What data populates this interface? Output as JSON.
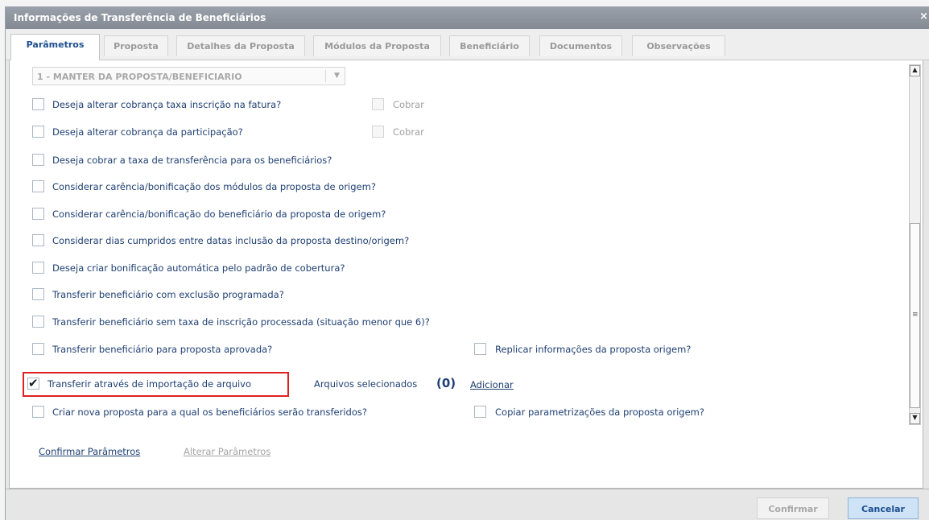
{
  "window": {
    "title": "Informações de Transferência de Beneficiários",
    "close_label": "×"
  },
  "tabs": [
    {
      "label": "Parâmetros",
      "active": true
    },
    {
      "label": "Proposta"
    },
    {
      "label": "Detalhes da Proposta"
    },
    {
      "label": "Módulos da Proposta"
    },
    {
      "label": "Beneficiário"
    },
    {
      "label": "Documentos"
    },
    {
      "label": "Observações"
    }
  ],
  "select": {
    "value": "1 - MANTER DA PROPOSTA/BENEFICIARIO",
    "arrow": "▼"
  },
  "options": [
    {
      "label": "Deseja alterar cobrança taxa inscrição na fatura?",
      "checked": false,
      "extra": {
        "label": "Cobrar",
        "disabled": true
      }
    },
    {
      "label": "Deseja alterar cobrança da participação?",
      "checked": false,
      "extra": {
        "label": "Cobrar",
        "disabled": true
      }
    },
    {
      "label": "Deseja cobrar a taxa de transferência para os beneficiários?",
      "checked": false
    },
    {
      "label": "Considerar carência/bonificação dos módulos da proposta de origem?",
      "checked": false
    },
    {
      "label": "Considerar carência/bonificação do beneficiário da proposta de origem?",
      "checked": false
    },
    {
      "label": "Considerar dias cumpridos entre datas inclusão da proposta destino/origem?",
      "checked": false
    },
    {
      "label": "Deseja criar bonificação automática pelo padrão de cobertura?",
      "checked": false
    },
    {
      "label": "Transferir beneficiário com exclusão programada?",
      "checked": false
    },
    {
      "label": "Transferir beneficiário sem taxa de inscrição processada (situação menor que 6)?",
      "checked": false
    },
    {
      "label": "Transferir beneficiário para proposta aprovada?",
      "checked": false,
      "extra": {
        "label": "Replicar informações da proposta origem?",
        "disabled": false
      }
    },
    {
      "label": "Transferir através de importação de arquivo",
      "checked": true,
      "check_glyph": "✔"
    },
    {
      "label": "Criar nova proposta para a qual os beneficiários serão transferidos?",
      "checked": false,
      "extra": {
        "label": "Copiar parametrizações da proposta origem?",
        "disabled": false
      }
    }
  ],
  "files": {
    "label": "Arquivos selecionados",
    "count": "(0)",
    "add_link": "Adicionar"
  },
  "links": {
    "confirm_params": "Confirmar Parâmetros",
    "change_params": "Alterar Parâmetros"
  },
  "scrollbar": {
    "up": "▲",
    "down": "▼",
    "grip": "≡"
  },
  "buttons": {
    "confirm": "Confirmar",
    "cancel": "Cancelar"
  },
  "colors": {
    "accent": "#1d4e8e",
    "highlight_border": "#e02020"
  }
}
